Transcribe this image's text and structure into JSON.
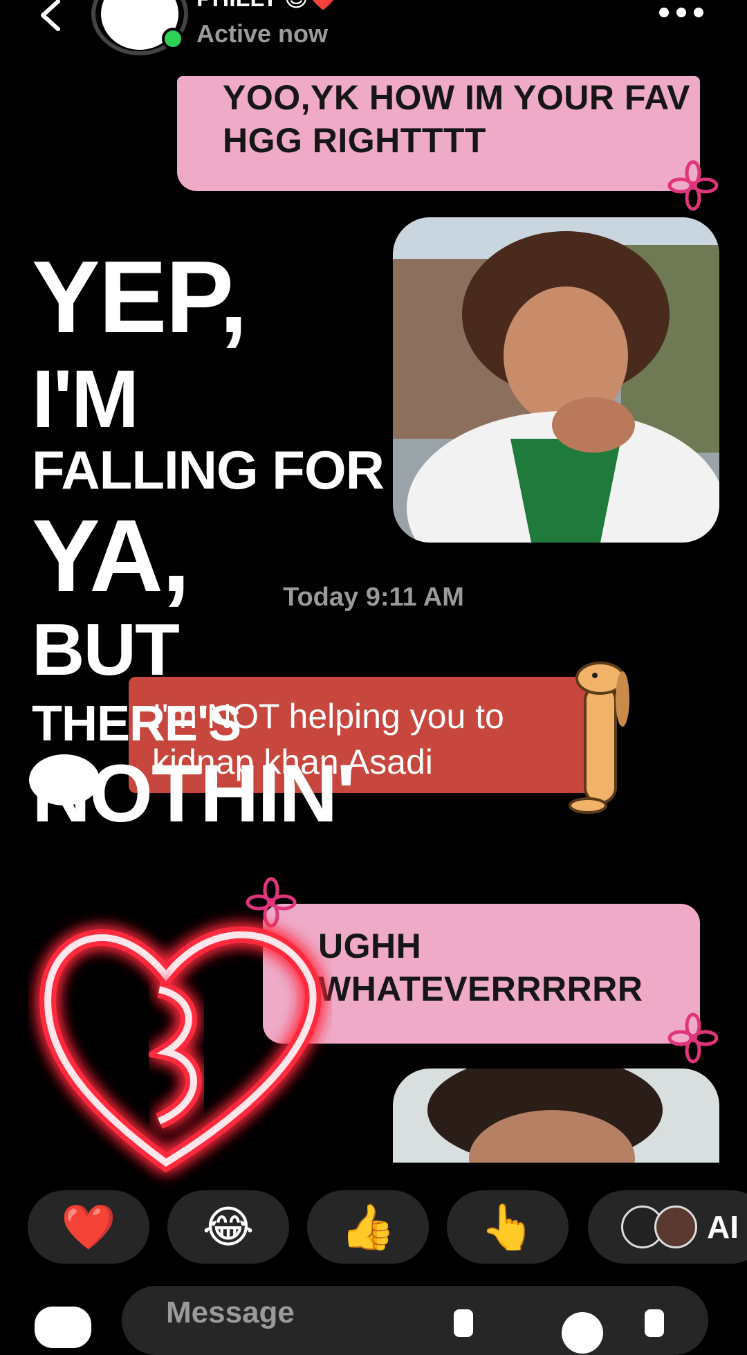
{
  "header": {
    "contact_name": "PHILLY 😉❤️",
    "status": "Active now"
  },
  "messages": {
    "received_1": "YOO,YK HOW IM YOUR FAV HGG RIGHTTTT",
    "timestamp": "Today 9:11 AM",
    "sent_red": "I'm NOT helping you to kidnap khan Asadi",
    "received_2": "UGHH WHATEVERRRRRR"
  },
  "overlay_lyrics": {
    "line1": "YEP,",
    "line2": "I'M",
    "line3": "FALLING FOR",
    "line4": "YA,",
    "line5": "BUT",
    "line6": "THERE'S",
    "line7": "NOTHIN'"
  },
  "reactions": [
    {
      "emoji": "❤️",
      "icon": "heart-icon"
    },
    {
      "emoji": "😂",
      "icon": "laughing-face-icon"
    },
    {
      "emoji": "👍",
      "icon": "thumbs-up-icon"
    },
    {
      "emoji": "👆",
      "icon": "pointing-hand-icon"
    },
    {
      "label": "AI",
      "icon": "ai-avatars-icon"
    }
  ],
  "composer": {
    "placeholder": "Message"
  },
  "colors": {
    "background": "#000000",
    "pink_bubble": "#eeaac7",
    "red_bubble": "#c7473f",
    "reaction_pill": "#262626",
    "muted_text": "#9a9a9a",
    "online": "#31d158"
  }
}
